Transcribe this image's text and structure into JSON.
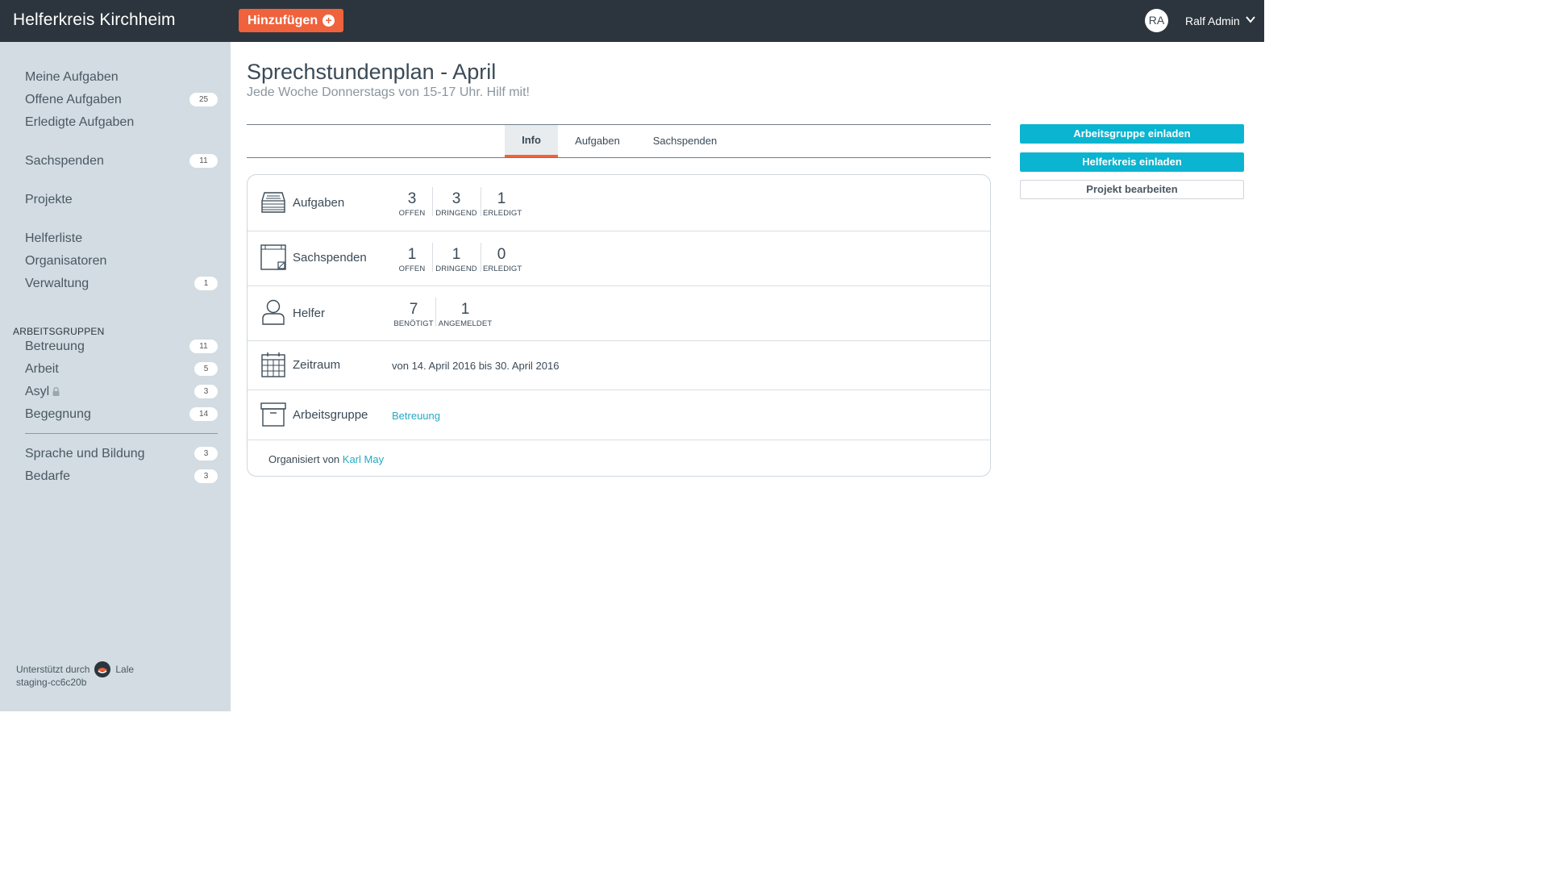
{
  "topbar": {
    "brand": "Helferkreis Kirchheim",
    "add_label": "Hinzufügen",
    "avatar_initials": "RA",
    "user_name": "Ralf Admin"
  },
  "sidebar": {
    "items": [
      {
        "label": "Meine Aufgaben",
        "badge": null
      },
      {
        "label": "Offene Aufgaben",
        "badge": "25"
      },
      {
        "label": "Erledigte Aufgaben",
        "badge": null
      },
      {
        "label": "Sachspenden",
        "badge": "11"
      },
      {
        "label": "Projekte",
        "badge": null
      },
      {
        "label": "Helferliste",
        "badge": null
      },
      {
        "label": "Organisatoren",
        "badge": null
      },
      {
        "label": "Verwaltung",
        "badge": "1"
      }
    ],
    "groups_title": "ARBEITSGRUPPEN",
    "groups": [
      {
        "label": "Betreuung",
        "badge": "11"
      },
      {
        "label": "Arbeit",
        "badge": "5"
      },
      {
        "label": "Asyl",
        "badge": "3",
        "locked": true
      },
      {
        "label": "Begegnung",
        "badge": "14"
      },
      {
        "label": "Sprache und Bildung",
        "badge": "3"
      },
      {
        "label": "Bedarfe",
        "badge": "3"
      }
    ],
    "footer": {
      "supported_by": "Unterstützt durch",
      "supporter": "Lale",
      "build": "staging-cc6c20b"
    }
  },
  "page": {
    "title": "Sprechstundenplan - April",
    "subtitle": "Jede Woche Donnerstags von 15-17 Uhr. Hilf mit!"
  },
  "tabs": [
    {
      "label": "Info",
      "active": true
    },
    {
      "label": "Aufgaben",
      "active": false
    },
    {
      "label": "Sachspenden",
      "active": false
    }
  ],
  "info": {
    "aufgaben": {
      "label": "Aufgaben",
      "stats": [
        {
          "value": "3",
          "label": "OFFEN"
        },
        {
          "value": "3",
          "label": "DRINGEND"
        },
        {
          "value": "1",
          "label": "ERLEDIGT"
        }
      ]
    },
    "sachspenden": {
      "label": "Sachspenden",
      "stats": [
        {
          "value": "1",
          "label": "OFFEN"
        },
        {
          "value": "1",
          "label": "DRINGEND"
        },
        {
          "value": "0",
          "label": "ERLEDIGT"
        }
      ]
    },
    "helfer": {
      "label": "Helfer",
      "stats": [
        {
          "value": "7",
          "label": "BENÖTIGT"
        },
        {
          "value": "1",
          "label": "ANGEMELDET"
        }
      ]
    },
    "zeitraum": {
      "label": "Zeitraum",
      "value": "von 14. April 2016 bis 30. April 2016"
    },
    "arbeitsgruppe": {
      "label": "Arbeitsgruppe",
      "value": "Betreuung"
    },
    "organizer": {
      "prefix": "Organisiert von",
      "name": "Karl May"
    }
  },
  "actions": {
    "invite_group": "Arbeitsgruppe einladen",
    "invite_circle": "Helferkreis einladen",
    "edit_project": "Projekt bearbeiten"
  },
  "colors": {
    "topbar": "#2c353d",
    "accent": "#f0623c",
    "primary_button": "#0bb4d0",
    "link": "#26a9c3",
    "sidebar": "#d2dce2"
  }
}
